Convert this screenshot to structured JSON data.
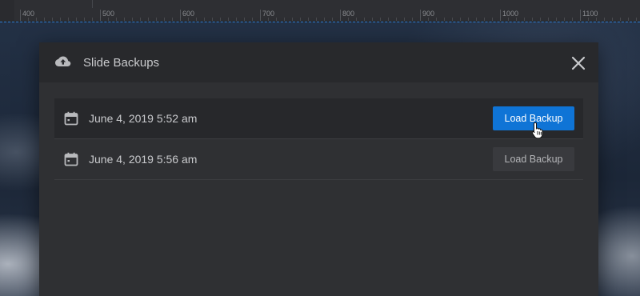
{
  "ruler": {
    "ticks": [
      {
        "label": "400"
      },
      {
        "label": "500"
      },
      {
        "label": "600"
      },
      {
        "label": "700"
      },
      {
        "label": "800"
      },
      {
        "label": "900"
      },
      {
        "label": "1000"
      },
      {
        "label": "1100"
      }
    ]
  },
  "modal": {
    "title": "Slide Backups",
    "header_icon": "cloud-upload-icon",
    "close_icon": "close-icon"
  },
  "backups": [
    {
      "date": "June 4, 2019 5:52 am",
      "button_label": "Load Backup",
      "state": "hover",
      "icon": "calendar-icon"
    },
    {
      "date": "June 4, 2019 5:56 am",
      "button_label": "Load Backup",
      "state": "default",
      "icon": "calendar-icon"
    }
  ],
  "colors": {
    "accent": "#0f74d6",
    "modal_bg": "#2f3033",
    "header_bg": "#28292c",
    "text": "#c9cacd"
  }
}
